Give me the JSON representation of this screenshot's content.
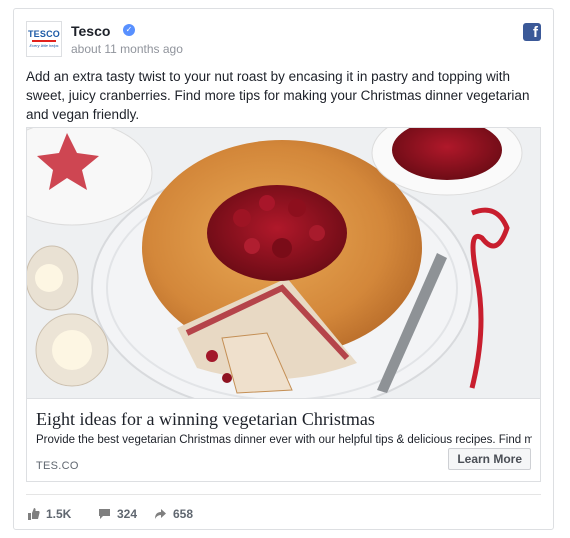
{
  "post": {
    "page_name": "Tesco",
    "verified_icon": "verified-badge-icon",
    "timestamp": "about 11 months ago",
    "network_icon": "facebook-icon",
    "avatar": {
      "brand": "TESCO",
      "tagline": "Every little helps"
    },
    "message": "Add an extra tasty twist to your nut roast by encasing it in pastry and topping with sweet, juicy cranberries. Find more tips for making your Christmas dinner vegetarian and vegan friendly."
  },
  "link": {
    "image_description_icon": "nut-roast-pie-photo",
    "title": "Eight ideas for a winning vegetarian Christmas",
    "description": "Provide the best vegetarian Christmas dinner ever with our helpful tips & delicious recipes. Find more...",
    "domain": "TES.CO",
    "cta_label": "Learn More"
  },
  "stats": {
    "likes": "1.5K",
    "comments": "324",
    "shares": "658"
  },
  "colors": {
    "facebook_blue": "#3b5998",
    "verified_blue": "#5890ff",
    "tesco_blue": "#1c5aa6",
    "tesco_red": "#e2211c"
  }
}
